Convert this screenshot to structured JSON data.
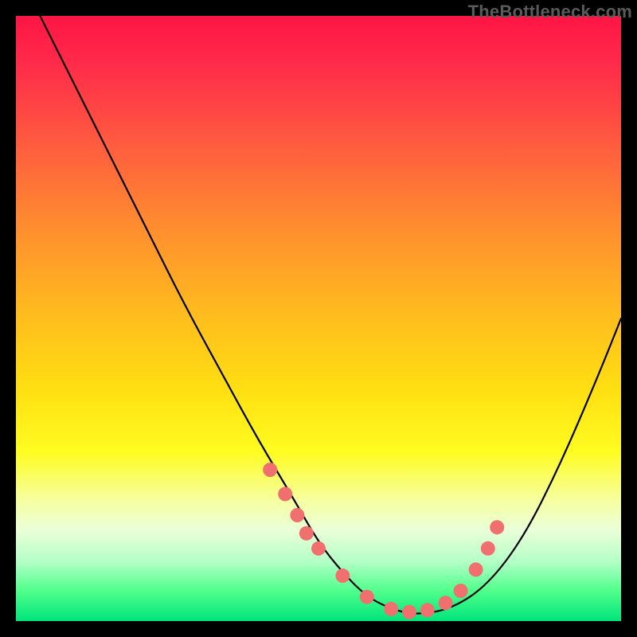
{
  "watermark": "TheBottleneck.com",
  "chart_data": {
    "type": "line",
    "title": "",
    "xlabel": "",
    "ylabel": "",
    "xlim": [
      0,
      100
    ],
    "ylim": [
      0,
      100
    ],
    "series": [
      {
        "name": "bottleneck-curve",
        "x": [
          4,
          10,
          16,
          22,
          28,
          34,
          40,
          46,
          50,
          54,
          58,
          62,
          66,
          72,
          78,
          84,
          90,
          96,
          100
        ],
        "values": [
          100,
          88,
          76,
          64,
          52,
          41,
          30,
          20,
          13,
          8,
          4,
          2,
          1,
          2,
          6,
          14,
          26,
          40,
          50
        ]
      }
    ],
    "markers": {
      "name": "highlight-dots",
      "color": "#f07070",
      "x": [
        42,
        44.5,
        46.5,
        48,
        50,
        54,
        58,
        62,
        65,
        68,
        71,
        73.5,
        76,
        78,
        79.5
      ],
      "values": [
        25,
        21,
        17.5,
        14.5,
        12,
        7.5,
        4,
        2,
        1.5,
        1.8,
        3,
        5,
        8.5,
        12,
        15.5
      ]
    },
    "gradient_stops": [
      {
        "pos": 0,
        "color": "#ff1544"
      },
      {
        "pos": 20,
        "color": "#ff5740"
      },
      {
        "pos": 48,
        "color": "#ffb81f"
      },
      {
        "pos": 72,
        "color": "#fffc20"
      },
      {
        "pos": 90,
        "color": "#b6ffc8"
      },
      {
        "pos": 100,
        "color": "#00e47a"
      }
    ]
  }
}
